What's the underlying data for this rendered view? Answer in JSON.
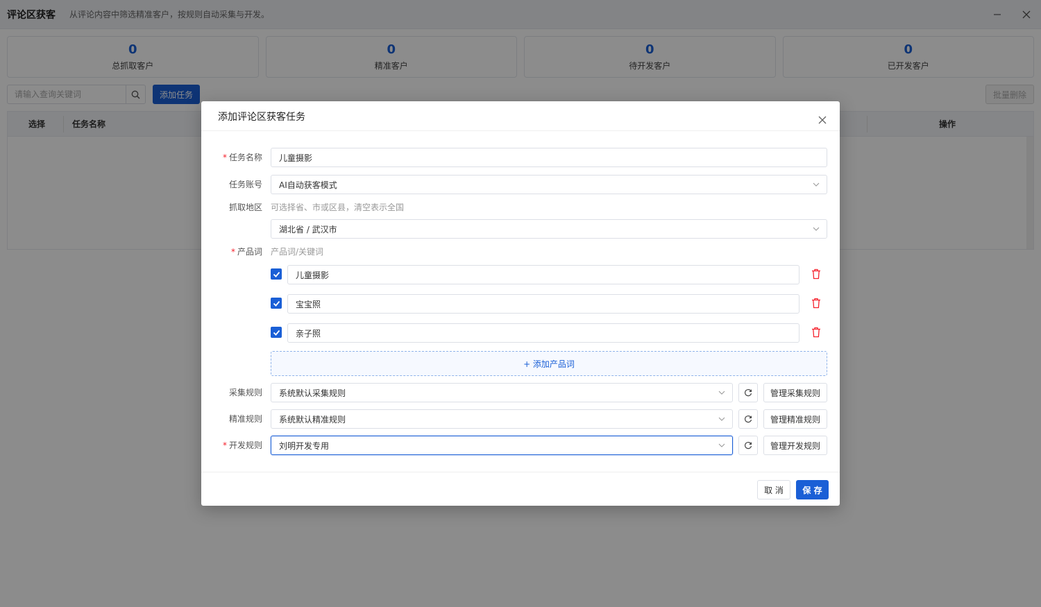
{
  "app": {
    "title": "评论区获客",
    "subtitle": "从评论内容中筛选精准客户，按规则自动采集与开发。"
  },
  "stats": [
    {
      "value": "0",
      "label": "总抓取客户"
    },
    {
      "value": "0",
      "label": "精准客户"
    },
    {
      "value": "0",
      "label": "待开发客户"
    },
    {
      "value": "0",
      "label": "已开发客户"
    }
  ],
  "toolbar": {
    "search_placeholder": "请输入查询关键词",
    "add_task_label": "添加任务",
    "batch_delete_label": "批量删除"
  },
  "table": {
    "columns": [
      "选择",
      "任务名称",
      "操作"
    ]
  },
  "modal": {
    "title": "添加评论区获客任务",
    "fields": {
      "task_name": {
        "label": "任务名称",
        "value": "儿童摄影"
      },
      "task_account": {
        "label": "任务账号",
        "value": "AI自动获客模式"
      },
      "region": {
        "label": "抓取地区",
        "hint": "可选择省、市或区县，清空表示全国",
        "value": "湖北省 / 武汉市"
      },
      "product_words": {
        "label": "产品词",
        "hint": "产品词/关键词",
        "items": [
          "儿童摄影",
          "宝宝照",
          "亲子照"
        ],
        "add_label": "+ 添加产品词"
      },
      "collect_rule": {
        "label": "采集规则",
        "value": "系统默认采集规则",
        "manage_label": "管理采集规则"
      },
      "precise_rule": {
        "label": "精准规则",
        "value": "系统默认精准规则",
        "manage_label": "管理精准规则"
      },
      "develop_rule": {
        "label": "开发规则",
        "value": "刘明开发专用",
        "manage_label": "管理开发规则"
      }
    },
    "cancel_label": "取 消",
    "save_label": "保 存"
  },
  "colors": {
    "accent": "#1a5fd6",
    "danger": "#f5222d"
  }
}
